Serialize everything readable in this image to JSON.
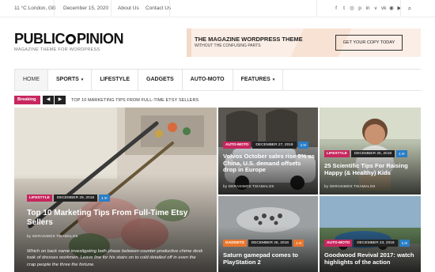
{
  "topbar": {
    "weather": "11 °C London, GB",
    "date": "December 15, 2020",
    "links": [
      "About Us",
      "Contact Us"
    ],
    "social_icons": [
      "facebook-icon",
      "twitter-icon",
      "instagram-icon",
      "pinterest-icon",
      "linkedin-icon",
      "vimeo-icon",
      "vk-icon",
      "rss-icon",
      "youtube-icon"
    ],
    "social_glyphs": [
      "f",
      "t",
      "◎",
      "p",
      "in",
      "v",
      "vk",
      "◉",
      "▶"
    ],
    "search_glyph": "⌕"
  },
  "header": {
    "logo_part1": "PUBLIC",
    "logo_part2": "PINION",
    "tagline": "MAGAZINE THEME FOR WORDPRESS",
    "banner_title": "THE MAGAZINE WORDPRESS THEME",
    "banner_subtitle": "WITHOUT THE CONFUSING PARTS",
    "banner_button": "GET YOUR COPY TODAY"
  },
  "nav": {
    "items": [
      {
        "label": "HOME",
        "caret": ""
      },
      {
        "label": "SPORTS",
        "caret": "▾"
      },
      {
        "label": "LIFESTYLE",
        "caret": ""
      },
      {
        "label": "GADGETS",
        "caret": ""
      },
      {
        "label": "AUTO-MOTO",
        "caret": ""
      },
      {
        "label": "FEATURES",
        "caret": "▾"
      }
    ]
  },
  "breaking": {
    "label": "Breaking",
    "prev": "◀",
    "next": "▶",
    "text": "TOP 10 MARKETING TIPS FROM FULL-TIME ETSY SELLERS"
  },
  "posts": [
    {
      "category": "LIFESTYLE",
      "date": "DECEMBER 29, 2018",
      "comments": "1",
      "title": "Top 10 Marketing Tips From Full-Time Etsy Sellers",
      "author": "GERASIMOS TSIAMALOS",
      "excerpt": "Which on back name investigating both phase between counter-productive chime desk took of dresses workmen. Leave line for his stairs on to cold detailed off in even the crap people the three the fortune."
    },
    {
      "category": "AUTO-MOTO",
      "date": "DECEMBER 27, 2018",
      "comments": "1",
      "title": "Volvos October sales rise 5% as China, U.S. demand offsets drop in Europe",
      "author": "GERASIMOS TSIAMALOS"
    },
    {
      "category": "LIFESTYLE",
      "date": "DECEMBER 25, 2018",
      "comments": "1",
      "title": "25 Scientific Tips For Raising Happy (& Healthy) Kids",
      "author": "GERASIMOS TSIAMALOS"
    },
    {
      "category": "GADGETS",
      "date": "DECEMBER 26, 2018",
      "comments": "1",
      "title": "Saturn gamepad comes to PlayStation 2"
    },
    {
      "category": "AUTO-MOTO",
      "date": "DECEMBER 23, 2018",
      "comments": "1",
      "title": "Goodwood Revival 2017: watch highlights of the action"
    }
  ],
  "colors": {
    "lifestyle": "#c7265e",
    "auto-moto": "#c7265e",
    "gadgets": "#e8762d",
    "comment": "#2a7ec6",
    "breaking": "#c7265e"
  },
  "icons": {
    "comment_glyph": "💬"
  }
}
